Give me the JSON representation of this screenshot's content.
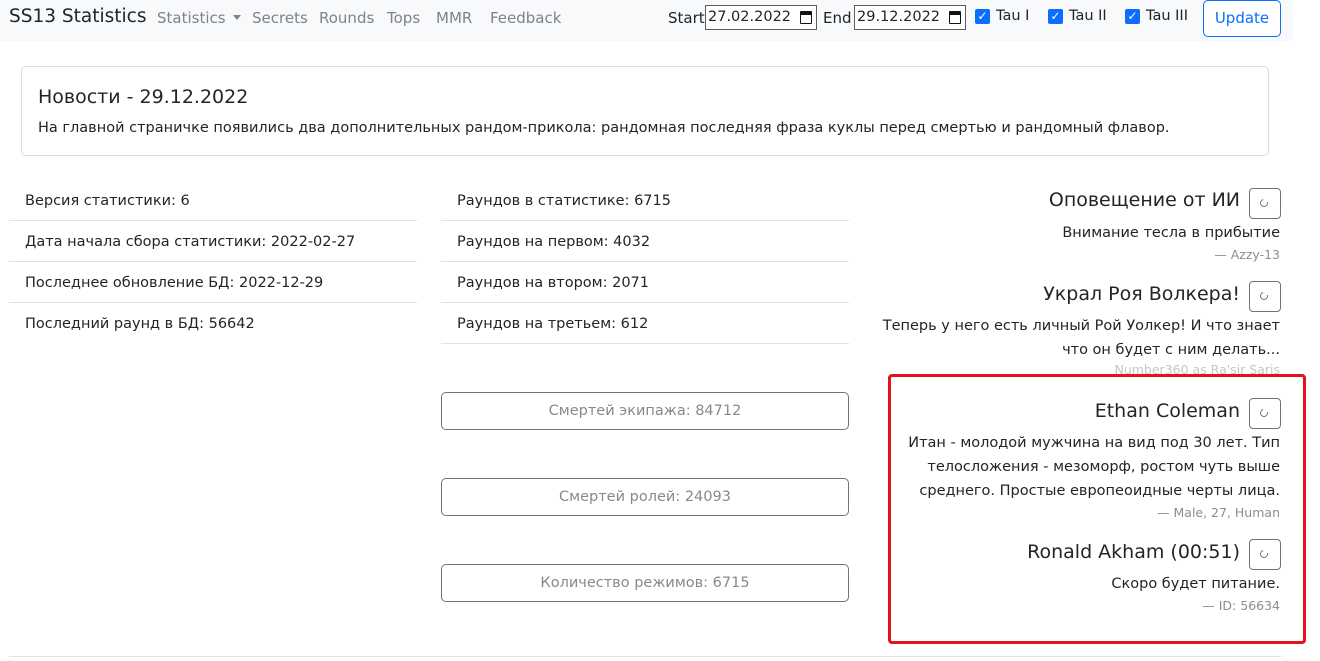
{
  "nav": {
    "brand": "SS13 Statistics",
    "links": [
      "Statistics",
      "Secrets",
      "Rounds",
      "Tops",
      "MMR",
      "Feedback"
    ],
    "start_label": "Start",
    "start_value": "27.02.2022",
    "end_label": "End",
    "end_value": "29.12.2022",
    "checks": [
      "Tau I",
      "Tau II",
      "Tau III"
    ],
    "update_label": "Update"
  },
  "news": {
    "title": "Новости - 29.12.2022",
    "body": "На главной страничке появились два дополнительных рандом-прикола: рандомная последняя фраза куклы перед смертью и рандомный флавор."
  },
  "info_left": [
    "Версия статистики: 6",
    "Дата начала сбора статистики: 2022-02-27",
    "Последнее обновление БД: 2022-12-29",
    "Последний раунд в БД: 56642"
  ],
  "info_right": [
    "Раундов в статистике: 6715",
    "Раундов на первом: 4032",
    "Раундов на втором: 2071",
    "Раундов на третьем: 612"
  ],
  "stat_buttons": [
    "Смертей экипажа: 84712",
    "Смертей ролей: 24093",
    "Количество режимов: 6715"
  ],
  "cards": {
    "ai": {
      "title": "Оповещение от ИИ",
      "text": "Внимание тесла в прибытие",
      "sub": "— Azzy-13"
    },
    "stole": {
      "title": "Украл Роя Волкера!",
      "line1": "Теперь у него есть личный Рой Уолкер! И что знает",
      "line2": "что он будет с ним делать...",
      "sub": "Number360 as Ra'sir Saris"
    },
    "flavor": {
      "title": "Ethan Coleman",
      "line1": "Итан - молодой мужчина на вид под 30 лет. Тип",
      "line2": "телосложения - мезоморф, ростом чуть выше",
      "line3": "среднего. Простые европеоидные черты лица.",
      "sub": "—  Male, 27, Human"
    },
    "lastword": {
      "title": "Ronald Akham (00:51)",
      "text": "Скоро будет питание.",
      "sub": "—  ID: 56634"
    }
  },
  "colors": {
    "accent": "#0d6efd",
    "highlight": "#e4121d",
    "navbar_bg": "#f8f9fa"
  }
}
